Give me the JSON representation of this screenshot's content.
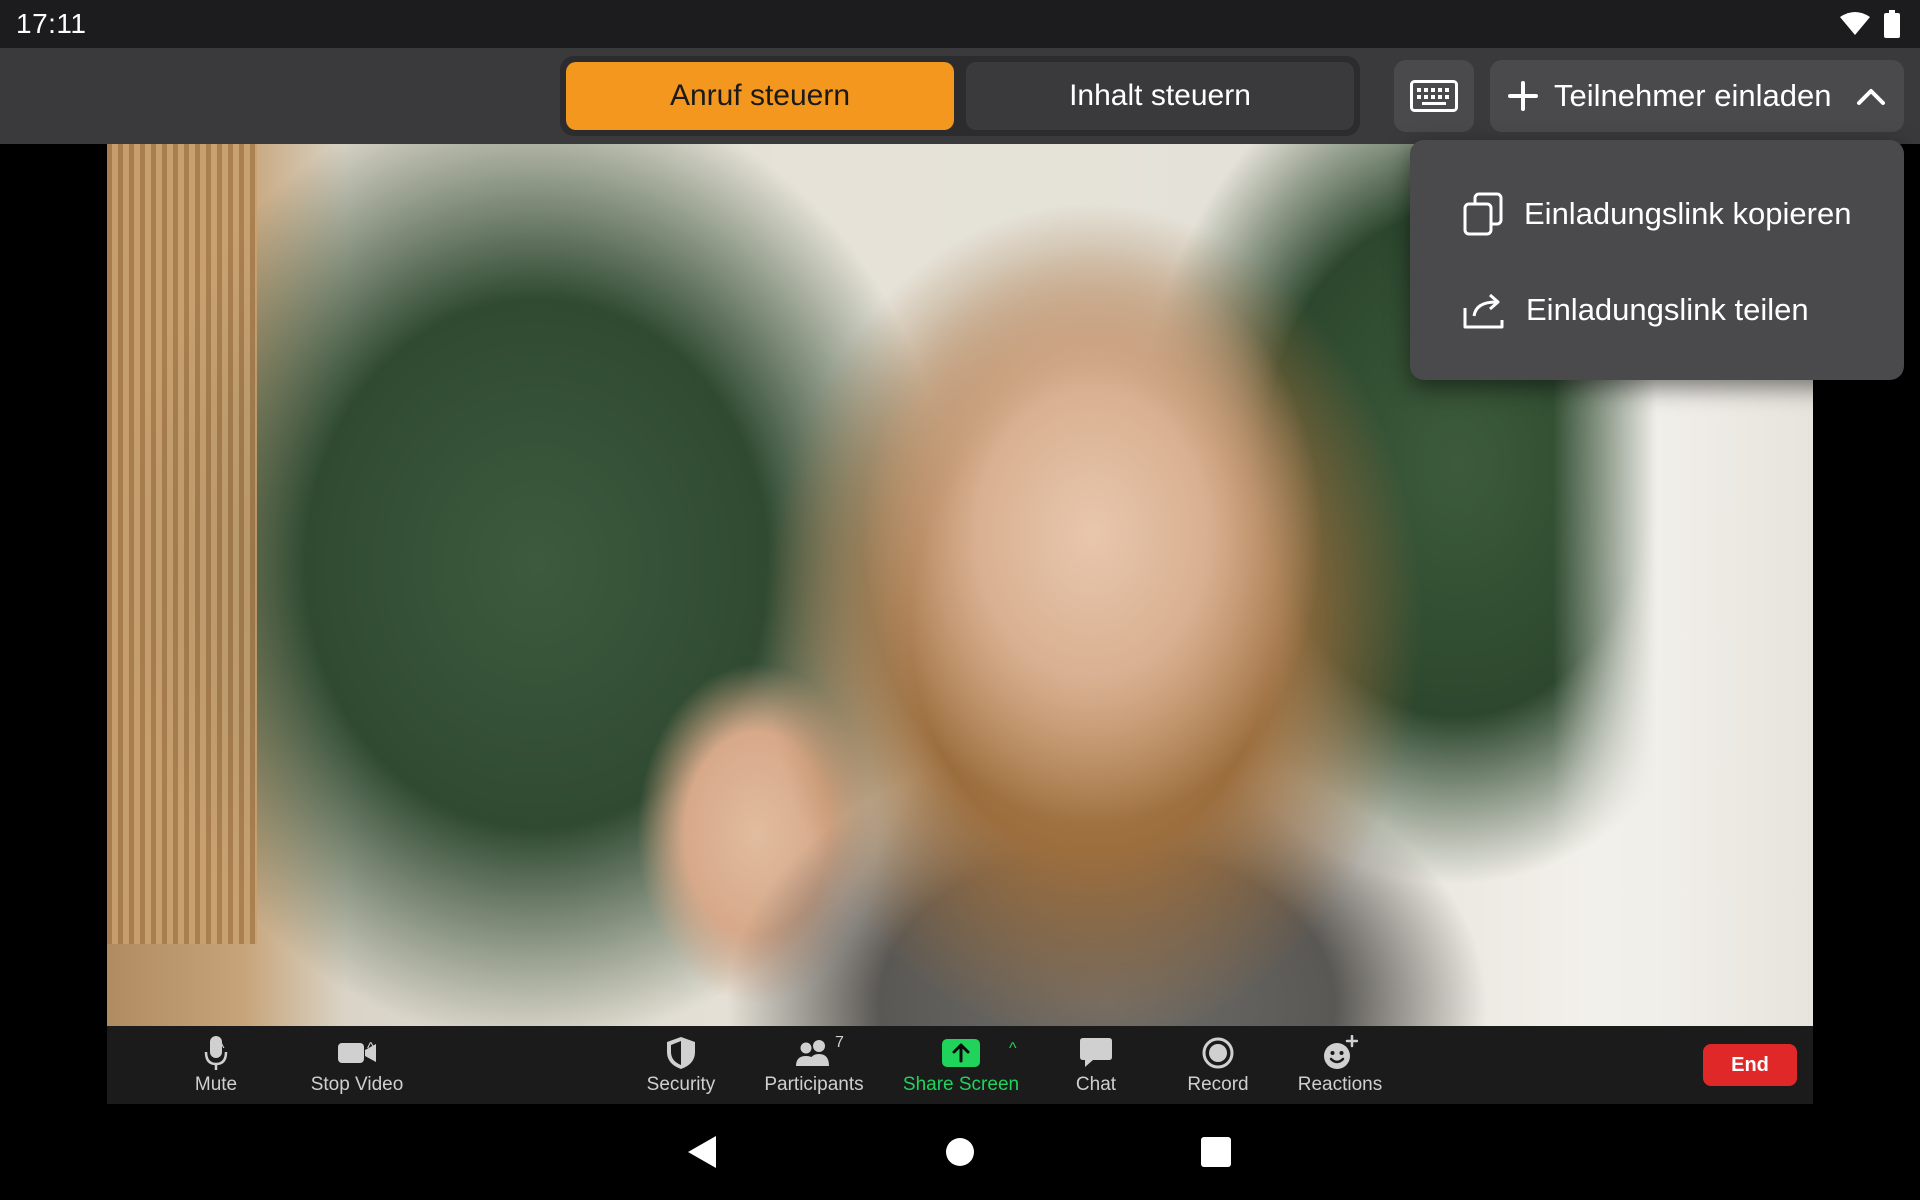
{
  "status_bar": {
    "time": "17:11"
  },
  "top_bar": {
    "tabs": [
      {
        "label": "Anruf steuern",
        "active": true
      },
      {
        "label": "Inhalt steuern",
        "active": false
      }
    ],
    "invite_label": "Teilnehmer einladen",
    "accent_color": "#f4971f"
  },
  "invite_menu": {
    "items": [
      {
        "label": "Einladungslink kopieren",
        "icon": "copy-icon"
      },
      {
        "label": "Einladungslink teilen",
        "icon": "share-icon"
      }
    ]
  },
  "toolbar": {
    "mute": "Mute",
    "stop_video": "Stop Video",
    "security": "Security",
    "participants": "Participants",
    "participants_count": "7",
    "share_screen": "Share Screen",
    "chat": "Chat",
    "record": "Record",
    "reactions": "Reactions",
    "end": "End",
    "share_color": "#1fd35b",
    "end_color": "#e02828"
  }
}
